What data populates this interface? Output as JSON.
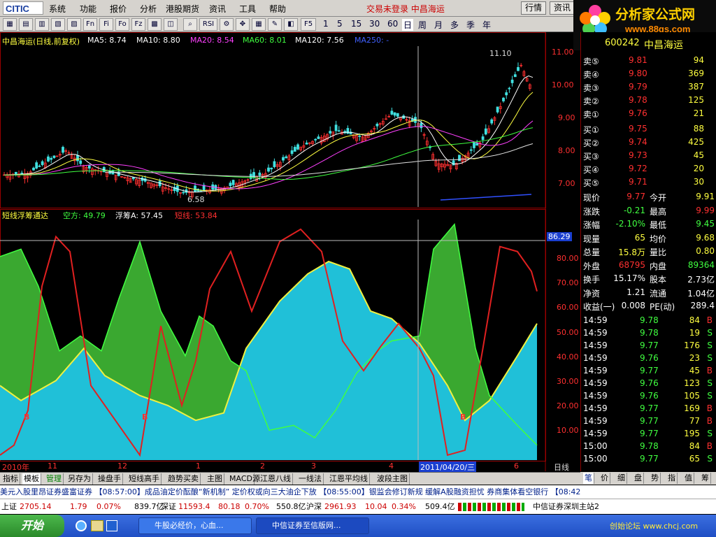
{
  "app": {
    "logo": "CITIC",
    "status": "交易未登录 中昌海运"
  },
  "menu": [
    "系统",
    "功能",
    "报价",
    "分析",
    "港股期货",
    "资讯",
    "工具",
    "帮助"
  ],
  "top_buttons": [
    "行情",
    "资讯"
  ],
  "brand": {
    "name": "分析家公式网",
    "url": "www.88gs.com"
  },
  "toolbar": {
    "icons": [
      "chart-icon",
      "chart-icon",
      "chart-icon",
      "chart-icon",
      "chart-icon",
      "chart-icon",
      "chart-icon"
    ],
    "labels": [
      "Fn",
      "Fi",
      "Fo",
      "Fz",
      "RSI",
      "F5"
    ],
    "periods": [
      "1",
      "5",
      "15",
      "30",
      "60",
      "日",
      "周",
      "月",
      "多",
      "季",
      "年"
    ]
  },
  "main_chart": {
    "title": "中昌海运(日线,前复权)",
    "ma": [
      {
        "label": "MA5: 8.74",
        "color": "#ffffff"
      },
      {
        "label": "MA10: 8.80",
        "color": "#ffffff"
      },
      {
        "label": "MA20: 8.54",
        "color": "#ff40ff"
      },
      {
        "label": "MA60: 8.01",
        "color": "#40ff40"
      },
      {
        "label": "MA120: 7.56",
        "color": "#ffffff"
      },
      {
        "label": "MA250: -",
        "color": "#4040ff"
      }
    ],
    "price_ticks": [
      "11.00",
      "10.00",
      "9.00",
      "8.00",
      "7.00"
    ],
    "high_label": "11.10",
    "low_label": "6.58"
  },
  "indicator": {
    "name": "短线浮筹通达",
    "values": [
      {
        "label": "空方: 49.79",
        "color": "#40ff40"
      },
      {
        "label": "浮筹A: 57.45",
        "color": "#ffffff"
      },
      {
        "label": "短线: 53.84",
        "color": "#ff3030"
      }
    ],
    "ticks": [
      "80.00",
      "70.00",
      "60.00",
      "50.00",
      "40.00",
      "30.00",
      "20.00",
      "10.00"
    ],
    "cursor_value": "86.29",
    "b_marks": [
      "B",
      "B",
      "B"
    ]
  },
  "time_axis": {
    "labels": [
      "2010年",
      "11",
      "12",
      "1",
      "2",
      "3",
      "4",
      "6",
      "日线"
    ],
    "cursor_date": "2011/04/20/三"
  },
  "quote": {
    "code": "600242",
    "name": "中昌海运",
    "sell": [
      {
        "label": "卖⑤",
        "price": "9.81",
        "vol": "94"
      },
      {
        "label": "卖④",
        "price": "9.80",
        "vol": "369"
      },
      {
        "label": "卖③",
        "price": "9.79",
        "vol": "387"
      },
      {
        "label": "卖②",
        "price": "9.78",
        "vol": "125"
      },
      {
        "label": "卖①",
        "price": "9.76",
        "vol": "21"
      }
    ],
    "buy": [
      {
        "label": "买①",
        "price": "9.75",
        "vol": "88"
      },
      {
        "label": "买②",
        "price": "9.74",
        "vol": "425"
      },
      {
        "label": "买③",
        "price": "9.73",
        "vol": "45"
      },
      {
        "label": "买④",
        "price": "9.72",
        "vol": "20"
      },
      {
        "label": "买⑤",
        "price": "9.71",
        "vol": "30"
      }
    ],
    "stats": [
      {
        "l1": "现价",
        "v1": "9.77",
        "l2": "今开",
        "v2": "9.91",
        "c1": "#ff3030",
        "c2": "#ffff40"
      },
      {
        "l1": "涨跌",
        "v1": "-0.21",
        "l2": "最高",
        "v2": "9.99",
        "c1": "#40ff40",
        "c2": "#ff3030"
      },
      {
        "l1": "涨幅",
        "v1": "-2.10%",
        "l2": "最低",
        "v2": "9.45",
        "c1": "#40ff40",
        "c2": "#40ff40"
      },
      {
        "l1": "现量",
        "v1": "65",
        "l2": "均价",
        "v2": "9.68",
        "c1": "#ffff40",
        "c2": "#ffff40"
      },
      {
        "l1": "总量",
        "v1": "15.8万",
        "l2": "量比",
        "v2": "0.80",
        "c1": "#ffff40",
        "c2": "#ffff40"
      },
      {
        "l1": "外盘",
        "v1": "68795",
        "l2": "内盘",
        "v2": "89364",
        "c1": "#ff3030",
        "c2": "#40ff40"
      },
      {
        "l1": "换手",
        "v1": "15.17%",
        "l2": "股本",
        "v2": "2.73亿",
        "c1": "#ffffff",
        "c2": "#ffffff"
      },
      {
        "l1": "净资",
        "v1": "1.21",
        "l2": "流通",
        "v2": "1.04亿",
        "c1": "#ffffff",
        "c2": "#ffffff"
      },
      {
        "l1": "收益(一)",
        "v1": "0.008",
        "l2": "PE(动)",
        "v2": "289.4",
        "c1": "#ffffff",
        "c2": "#ffffff"
      }
    ],
    "ticks": [
      {
        "t": "14:59",
        "p": "9.78",
        "v": "84",
        "s": "B"
      },
      {
        "t": "14:59",
        "p": "9.78",
        "v": "19",
        "s": "S"
      },
      {
        "t": "14:59",
        "p": "9.77",
        "v": "176",
        "s": "S"
      },
      {
        "t": "14:59",
        "p": "9.76",
        "v": "23",
        "s": "S"
      },
      {
        "t": "14:59",
        "p": "9.77",
        "v": "45",
        "s": "B"
      },
      {
        "t": "14:59",
        "p": "9.76",
        "v": "123",
        "s": "S"
      },
      {
        "t": "14:59",
        "p": "9.76",
        "v": "105",
        "s": "S"
      },
      {
        "t": "14:59",
        "p": "9.77",
        "v": "169",
        "s": "B"
      },
      {
        "t": "14:59",
        "p": "9.77",
        "v": "77",
        "s": "B"
      },
      {
        "t": "14:59",
        "p": "9.77",
        "v": "195",
        "s": "S"
      },
      {
        "t": "15:00",
        "p": "9.78",
        "v": "84",
        "s": "B"
      },
      {
        "t": "15:00",
        "p": "9.77",
        "v": "65",
        "s": "S"
      }
    ]
  },
  "bottom_tabs": [
    "指标",
    "模板",
    "管理",
    "另存为",
    "操盘手",
    "短线高手",
    "趋势买卖",
    "主图",
    "MACD",
    "源江恩八线",
    "一线法",
    "江恩平均线",
    "波段主图"
  ],
  "right_tabs": [
    "笔",
    "价",
    "细",
    "盘",
    "势",
    "指",
    "值",
    "筹"
  ],
  "ticker": "美元入股里昂证券盛富证券    【08:57:00】成品油定价酝酿“新机制” 定价权或向三大油企下放    【08:55:00】银监会修订新规 缓解A股融资担忧 券商集体看空银行  【08:42",
  "indices": [
    {
      "name": "上证",
      "val": "2705.14",
      "chg": "1.79",
      "pct": "0.07%",
      "amt": "839.7亿"
    },
    {
      "name": "深证",
      "val": "11593.4",
      "chg": "80.18",
      "pct": "0.70%",
      "amt": "550.8亿"
    },
    {
      "name": "沪深",
      "val": "2961.93",
      "chg": "10.04",
      "pct": "0.34%",
      "amt": "509.4亿"
    }
  ],
  "server": "中信证券深圳主站2",
  "taskbar": {
    "start": "开始",
    "tasks": [
      "牛股必经价，心血...",
      "中信证券至信版网..."
    ],
    "site": "创始论坛 www.chcj.com"
  }
}
